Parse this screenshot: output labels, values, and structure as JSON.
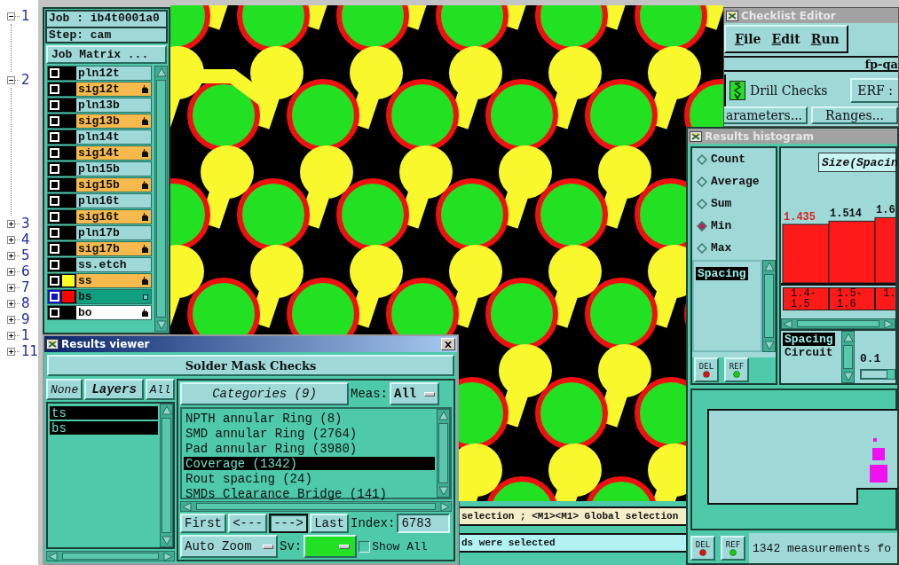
{
  "tree": {
    "items": [
      {
        "label": "1",
        "expanded": true
      },
      {
        "label": "2",
        "expanded": true
      },
      {
        "label": "3",
        "expanded": false
      },
      {
        "label": "4",
        "expanded": false
      },
      {
        "label": "5",
        "expanded": false
      },
      {
        "label": "6",
        "expanded": false
      },
      {
        "label": "7",
        "expanded": false
      },
      {
        "label": "8",
        "expanded": false
      },
      {
        "label": "9",
        "expanded": false
      },
      {
        "label": "1",
        "expanded": false
      },
      {
        "label": "11",
        "expanded": false
      }
    ]
  },
  "layer_panel": {
    "job": "Job : ib4t0001a0",
    "step": "Step: cam",
    "matrix_button": "Job Matrix ...",
    "layers": [
      {
        "name": "pln12t",
        "kind": "plane",
        "selected": false
      },
      {
        "name": "sig12t",
        "kind": "signal",
        "selected": false
      },
      {
        "name": "pln13b",
        "kind": "plane",
        "selected": false
      },
      {
        "name": "sig13b",
        "kind": "signal",
        "selected": false
      },
      {
        "name": "pln14t",
        "kind": "plane",
        "selected": false
      },
      {
        "name": "sig14t",
        "kind": "signal",
        "selected": false
      },
      {
        "name": "pln15b",
        "kind": "plane",
        "selected": false
      },
      {
        "name": "sig15b",
        "kind": "signal",
        "selected": false
      },
      {
        "name": "pln16t",
        "kind": "plane",
        "selected": false
      },
      {
        "name": "sig16t",
        "kind": "signal",
        "selected": false
      },
      {
        "name": "pln17b",
        "kind": "plane",
        "selected": false
      },
      {
        "name": "sig17b",
        "kind": "signal",
        "selected": false
      },
      {
        "name": "ss.etch",
        "kind": "plane",
        "selected": false
      },
      {
        "name": "ss",
        "kind": "signal",
        "color": "#ffff22",
        "selected": false
      },
      {
        "name": "bs",
        "kind": "signal",
        "color": "#ff0000",
        "selected": true
      },
      {
        "name": "bo",
        "kind": "document",
        "selected": false
      }
    ]
  },
  "status": {
    "hint": "selection ; <M1><M1> Global selection",
    "message": "ds were selected"
  },
  "checklist_editor": {
    "title": "Checklist Editor",
    "menu": [
      "File",
      "Edit",
      "Run"
    ],
    "checklist": "fp-qa",
    "check": "Drill Checks",
    "erf_button": "ERF :",
    "buttons": [
      "arameters...",
      "Ranges..."
    ]
  },
  "results_histogram": {
    "title": "Results histogram",
    "functions": [
      {
        "label": "Count",
        "selected": false
      },
      {
        "label": "Average",
        "selected": false
      },
      {
        "label": "Sum",
        "selected": false
      },
      {
        "label": "Min",
        "selected": true
      },
      {
        "label": "Max",
        "selected": false
      }
    ],
    "measures": [
      {
        "label": "Spacing",
        "selected": true
      }
    ],
    "buttons": [
      "DEL",
      "REF"
    ],
    "chart_data": {
      "type": "bar",
      "title": "Size(Spacin",
      "categories": [
        "1.4-1.5",
        "1.5-1.6",
        "1."
      ],
      "series": [
        {
          "color": "#ff1a1a",
          "values": [
            1.435,
            1.514,
            1.6
          ]
        }
      ],
      "data_labels": true
    },
    "attributes": [
      {
        "label": "Spacing",
        "selected": true
      },
      {
        "label": "Circuit",
        "selected": false
      }
    ],
    "slider": {
      "value": "0.1"
    },
    "map_buttons": [
      "DEL",
      "REF"
    ],
    "summary": "1342 measurements fo"
  },
  "results_viewer": {
    "title": "Results viewer",
    "checklist": "Solder Mask Checks",
    "layer_buttons": [
      "None",
      "Layers",
      "All"
    ],
    "layers": [
      {
        "name": "ts",
        "selected": true
      },
      {
        "name": "bs",
        "selected": true
      }
    ],
    "categories_button": "Categories (9)",
    "meas_label": "Meas:",
    "meas_value": "All",
    "categories": [
      {
        "label": "NPTH annular Ring (8)",
        "selected": false
      },
      {
        "label": "SMD annular Ring (2764)",
        "selected": false
      },
      {
        "label": "Pad annular Ring (3980)",
        "selected": false
      },
      {
        "label": "Coverage (1342)",
        "selected": true
      },
      {
        "label": "Rout spacing (24)",
        "selected": false
      },
      {
        "label": "SMDs Clearance Bridge (141)",
        "selected": false
      }
    ],
    "nav_buttons": [
      {
        "label": "First",
        "selected": false
      },
      {
        "label": "<---",
        "selected": false
      },
      {
        "label": "--->",
        "selected": true
      },
      {
        "label": "Last",
        "selected": false
      }
    ],
    "index_label": "Index:",
    "index_value": "6783",
    "zoom_mode": "Auto Zoom",
    "sv_label": "Sv:",
    "show_all": {
      "label": "Show All",
      "checked": false
    }
  }
}
